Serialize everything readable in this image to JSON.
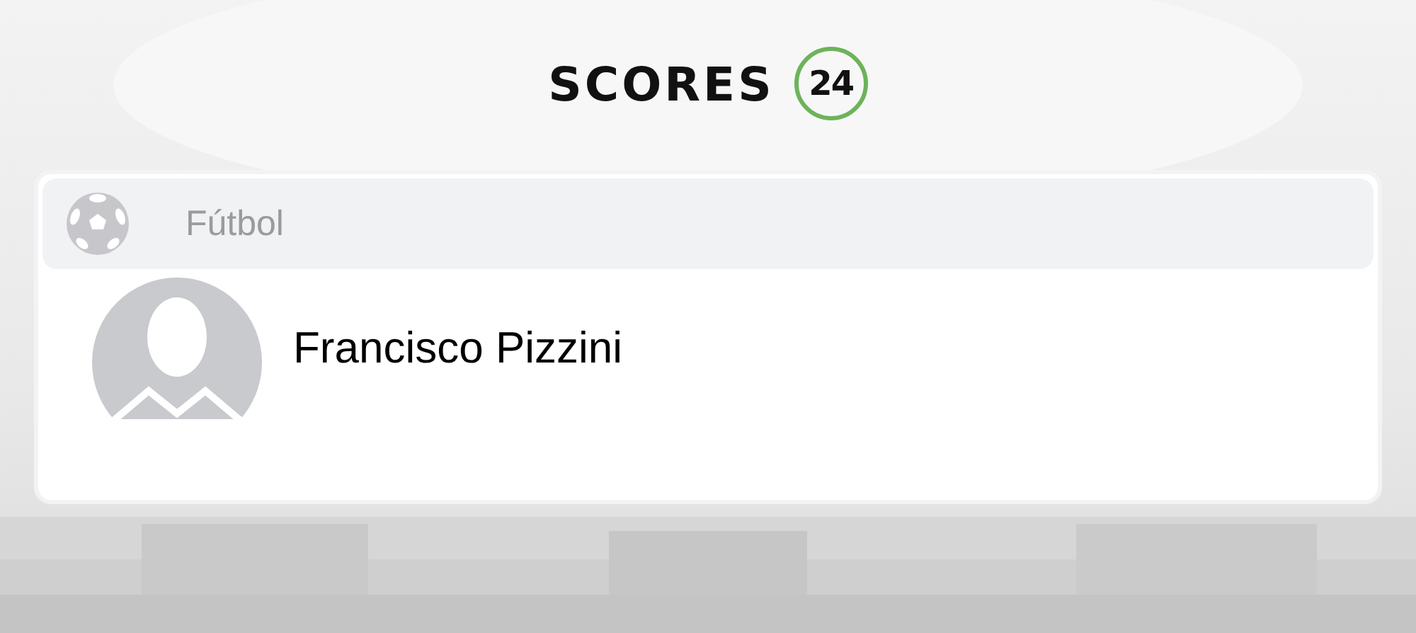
{
  "logo": {
    "text": "SCORES",
    "badge": "24"
  },
  "category": {
    "label": "Fútbol"
  },
  "results": [
    {
      "name": "Francisco Pizzini"
    }
  ]
}
